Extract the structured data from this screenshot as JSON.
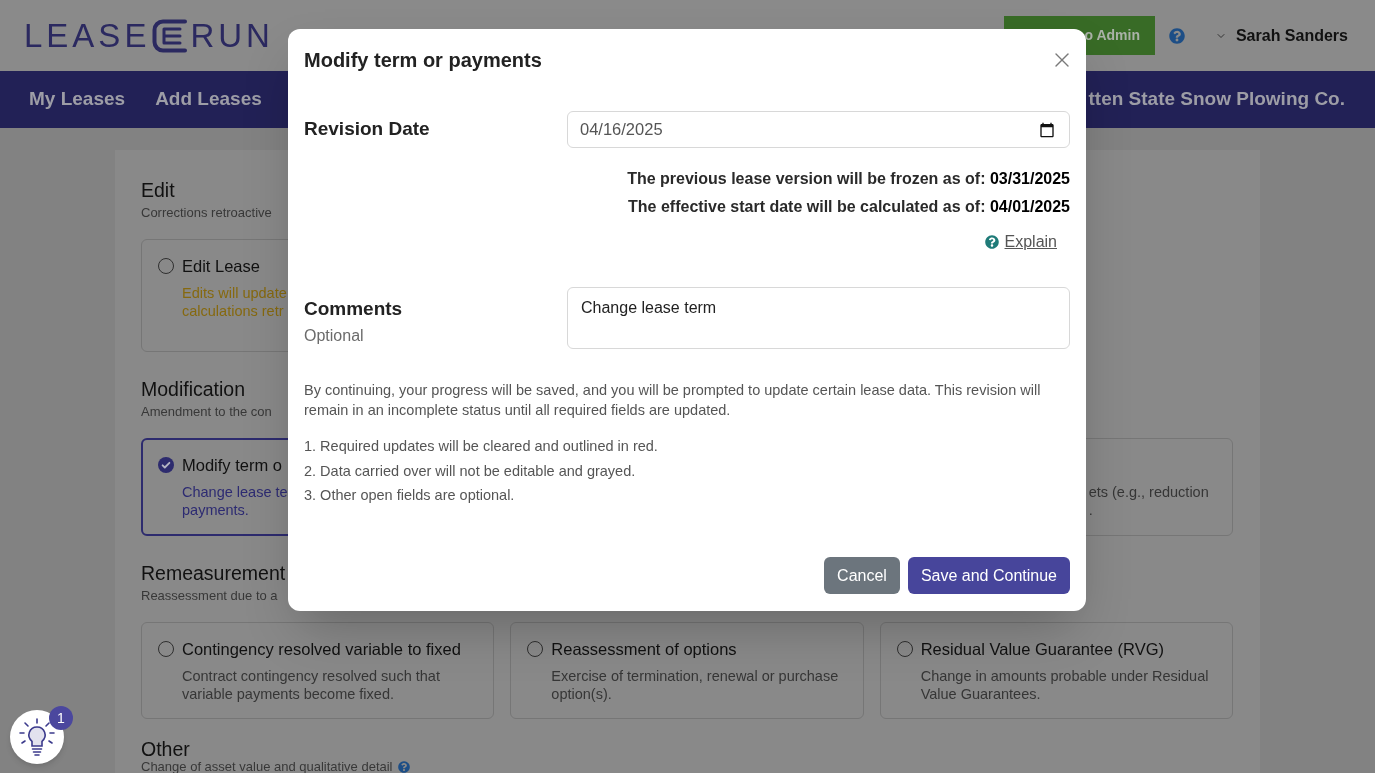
{
  "header": {
    "logo": {
      "left": "LEASE",
      "right": "RUN"
    },
    "admin_button": "o Admin",
    "user_name": "Sarah Sanders"
  },
  "nav": {
    "links": [
      "My Leases",
      "Add Leases"
    ],
    "company": "tten State Snow Plowing Co."
  },
  "sections": [
    {
      "title": "Edit",
      "subtitle": "Corrections retroactive",
      "cards": [
        {
          "kind": "warning",
          "title": "Edit Lease",
          "lines": [
            "Edits will update",
            "calculations retr"
          ],
          "selected": false
        }
      ]
    },
    {
      "title": "Modification",
      "subtitle": "Amendment to the con",
      "cards": [
        {
          "kind": "standard",
          "title": "Modify term o",
          "lines": [
            "Change lease te",
            "payments."
          ],
          "selected": true
        },
        {
          "kind": "standard",
          "lines": [
            "ets (e.g., reduction",
            "."
          ]
        }
      ]
    },
    {
      "title": "Remeasurement",
      "subtitle": "Reassessment due to a",
      "cards": [
        {
          "kind": "standard",
          "title": "Contingency resolved variable to fixed",
          "description": "Contract contingency resolved such that variable payments become fixed.",
          "selected": false
        },
        {
          "kind": "standard",
          "title": "Reassessment of options",
          "description": "Exercise of termination, renewal or purchase option(s).",
          "selected": false
        },
        {
          "kind": "standard",
          "title": "Residual Value Guarantee (RVG)",
          "description": "Change in amounts probable under Residual Value Guarantees.",
          "selected": false
        }
      ]
    },
    {
      "title": "Other",
      "subtitle": "Change of asset value and qualitative detail",
      "has_help": true
    }
  ],
  "dialog": {
    "title": "Modify term or payments",
    "revision_date": {
      "label": "Revision Date",
      "value": "04/16/2025"
    },
    "notes": [
      "The previous lease version will be frozen as of: **03/31/2025**",
      "The effective start date will be calculated as of: **04/01/2025**"
    ],
    "explain_link": "Explain",
    "comments": {
      "label": "Comments",
      "hint": "Optional",
      "value": "Change lease term"
    },
    "info": "By continuing, your progress will be saved, and you will be prompted to update certain lease data. This revision will remain in an incomplete status until all required fields are updated.",
    "steps": [
      "1. Required updates will be cleared and outlined in red.",
      "2. Data carried over will not be editable and grayed.",
      "3. Other open fields are optional."
    ],
    "buttons": [
      {
        "label": "Cancel",
        "kind": "secondary"
      },
      {
        "label": "Save and Continue",
        "kind": "primary"
      }
    ]
  },
  "help_widget": {
    "badge": "1"
  }
}
